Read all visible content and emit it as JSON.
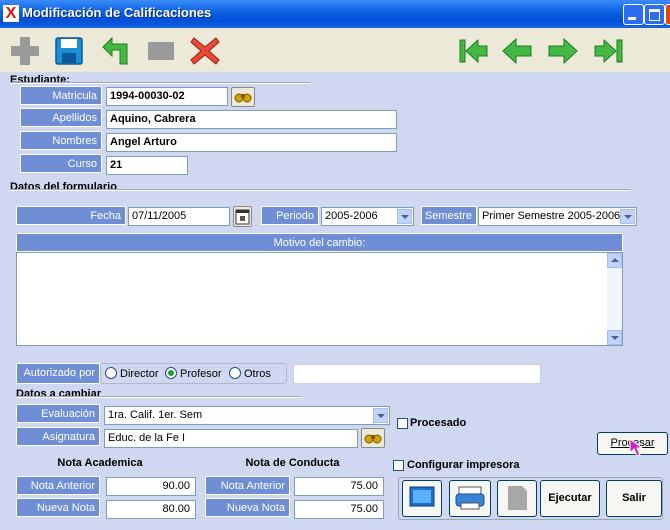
{
  "window": {
    "title": "Modificación de Calificaciones",
    "app_icon_glyph": "X",
    "title_color": "#0a5fe0"
  },
  "toolbar": {
    "icons": [
      "add-icon",
      "save-icon",
      "undo-icon",
      "blank-icon",
      "delete-icon",
      "first-record-icon",
      "previous-record-icon",
      "next-record-icon",
      "last-record-icon"
    ]
  },
  "student": {
    "section_title": "Estudiante:",
    "matricula_label": "Matricula",
    "matricula_value": "1994-00030-02",
    "apellidos_label": "Apellidos",
    "apellidos_value": "Aquino, Cabrera",
    "nombres_label": "Nombres",
    "nombres_value": "Angel Arturo",
    "curso_label": "Curso",
    "curso_value": "21"
  },
  "form": {
    "section_title": "Datos del formulario",
    "fecha_label": "Fecha",
    "fecha_value": "07/11/2005",
    "periodo_label": "Periodo",
    "periodo_value": "2005-2006",
    "semestre_label": "Semestre",
    "semestre_value": "Primer Semestre 2005-2006",
    "motivo_label": "Motivo del cambio:",
    "motivo_value": "",
    "autorizado_label": "Autorizado por",
    "radio_options": [
      "Director",
      "Profesor",
      "Otros"
    ],
    "radio_selected": "Profesor",
    "otros_value": ""
  },
  "change": {
    "section_title": "Datos a cambiar",
    "evaluacion_label": "Evaluación",
    "evaluacion_value": "1ra. Calif. 1er. Sem",
    "asignatura_label": "Asignatura",
    "asignatura_value": "Educ. de la Fe I",
    "procesado_label": "Procesado",
    "procesar_label": "Procesar",
    "nota_academica_title": "Nota Academica",
    "nota_conducta_title": "Nota de Conducta",
    "nota_anterior_label": "Nota Anterior",
    "nueva_nota_label": "Nueva Nota",
    "acad_anterior": "90.00",
    "acad_nueva": "80.00",
    "cond_anterior": "75.00",
    "cond_nueva": "75.00",
    "configurar_label": "Configurar impresora"
  },
  "actions": {
    "ejecutar_label": "Ejecutar",
    "salir_label": "Salir"
  },
  "colors": {
    "label_bg": "#6f8ed6",
    "panel_bg": "#cfd8f0"
  }
}
